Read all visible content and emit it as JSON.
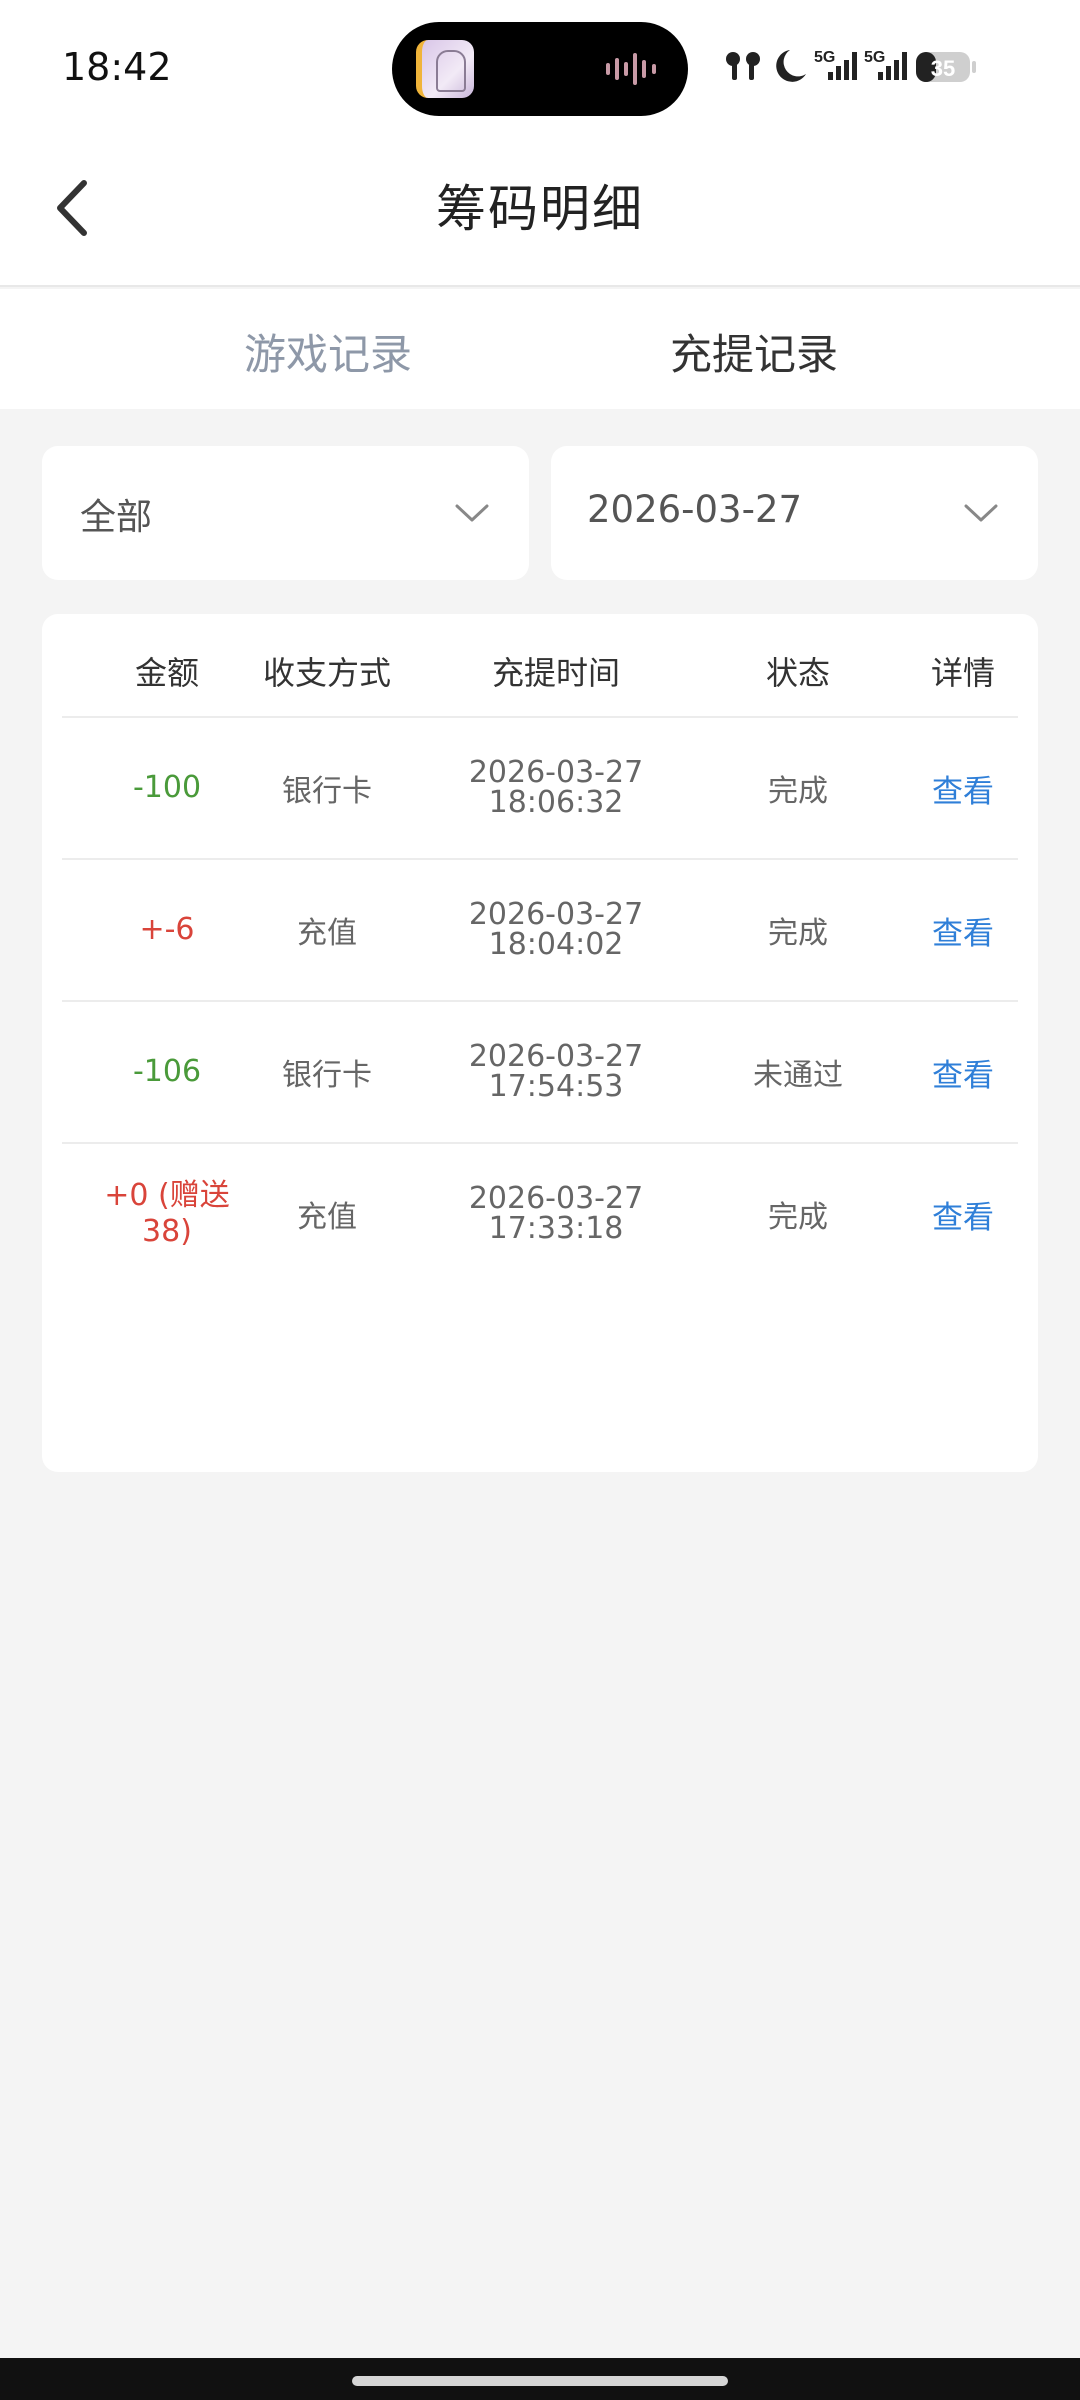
{
  "status_bar": {
    "time": "18:42",
    "net_label_1": "5G",
    "net_label_2": "5G",
    "battery": "35"
  },
  "header": {
    "title": "筹码明细"
  },
  "tabs": [
    {
      "label": "游戏记录",
      "active": false
    },
    {
      "label": "充提记录",
      "active": true
    }
  ],
  "filters": {
    "type_value": "全部",
    "date_value": "2026-03-27"
  },
  "table": {
    "columns": [
      "金额",
      "收支方式",
      "充提时间",
      "状态",
      "详情"
    ],
    "rows": [
      {
        "amount": "-100",
        "method": "银行卡",
        "date": "2026-03-27",
        "time": "18:06:32",
        "status": "完成",
        "detail": "查看"
      },
      {
        "amount": "+-6",
        "method": "充值",
        "date": "2026-03-27",
        "time": "18:04:02",
        "status": "完成",
        "detail": "查看"
      },
      {
        "amount": "-106",
        "method": "银行卡",
        "date": "2026-03-27",
        "time": "17:54:53",
        "status": "未通过",
        "detail": "查看"
      },
      {
        "amount": "+0 (赠送38)",
        "method": "充值",
        "date": "2026-03-27",
        "time": "17:33:18",
        "status": "完成",
        "detail": "查看"
      }
    ]
  },
  "colors": {
    "negative_amount": "#4a9a3a",
    "positive_amount": "#d9443a",
    "link": "#2f7fd8",
    "inactive_tab": "#8e98a8"
  }
}
